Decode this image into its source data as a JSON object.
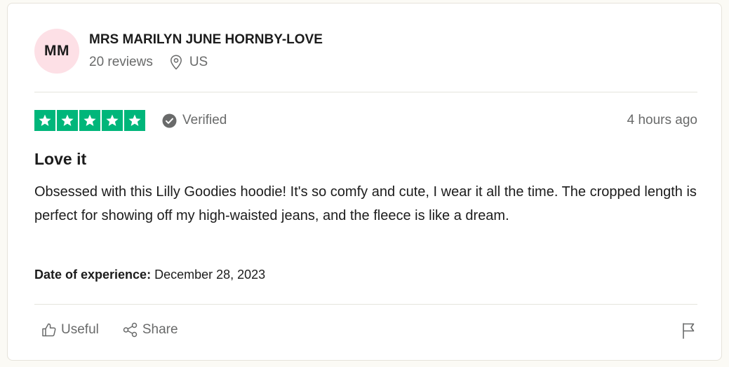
{
  "consumer": {
    "initials": "MM",
    "name": "MRS MARILYN JUNE HORNBY-LOVE",
    "reviews": "20 reviews",
    "location": "US",
    "avatar_color": "#fde0e6"
  },
  "rating": {
    "stars": 5,
    "max": 5,
    "star_color": "#00b67a",
    "verified_label": "Verified",
    "time_ago": "4 hours ago"
  },
  "review": {
    "title": "Love it",
    "text": "Obsessed with this Lilly Goodies hoodie! It's so comfy and cute, I wear it all the time. The cropped length is perfect for showing off my high-waisted jeans, and the fleece is like a dream.",
    "experience_label": "Date of experience:",
    "experience_date": "December 28, 2023"
  },
  "actions": {
    "useful_label": "Useful",
    "share_label": "Share",
    "useful_icon": "thumbs-up-icon",
    "share_icon": "share-icon",
    "flag_icon": "flag-icon"
  }
}
